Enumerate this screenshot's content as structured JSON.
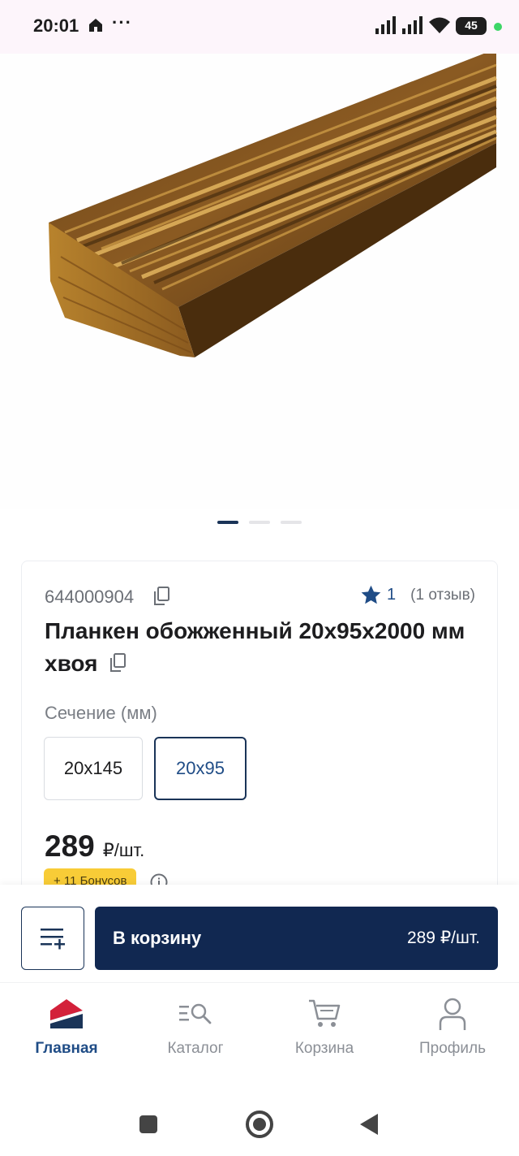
{
  "status_bar": {
    "time": "20:01",
    "dots": "···",
    "battery_level": "45",
    "icons": [
      "home-icon",
      "more-icon",
      "signal-icon",
      "signal-icon",
      "wifi-icon",
      "battery-icon"
    ]
  },
  "gallery": {
    "pages": 3,
    "active_index": 0
  },
  "product": {
    "sku": "644000904",
    "rating_value": "1",
    "reviews_text": "(1 отзыв)",
    "title": "Планкен обожженный 20x95x2000 мм хвоя",
    "section_label": "Сечение (мм)",
    "options": [
      "20x145",
      "20x95"
    ],
    "selected_option": "20x95",
    "price_value": "289",
    "price_unit": "₽/шт.",
    "bonus_text": "+ 11 Бонусов"
  },
  "actions": {
    "add_to_list_icon": "list-add-icon",
    "cart_button_label": "В корзину",
    "cart_button_price": "289 ₽/шт."
  },
  "bottom_nav": {
    "items": [
      {
        "label": "Главная",
        "icon": "home-logo-icon",
        "active": true
      },
      {
        "label": "Каталог",
        "icon": "catalog-search-icon",
        "active": false
      },
      {
        "label": "Корзина",
        "icon": "cart-icon",
        "active": false
      },
      {
        "label": "Профиль",
        "icon": "profile-icon",
        "active": false
      }
    ]
  },
  "colors": {
    "brand_dark_blue": "#112851",
    "accent_blue": "#1f4c86",
    "bonus_yellow": "#f8cc37",
    "brand_red": "#d3213a"
  }
}
